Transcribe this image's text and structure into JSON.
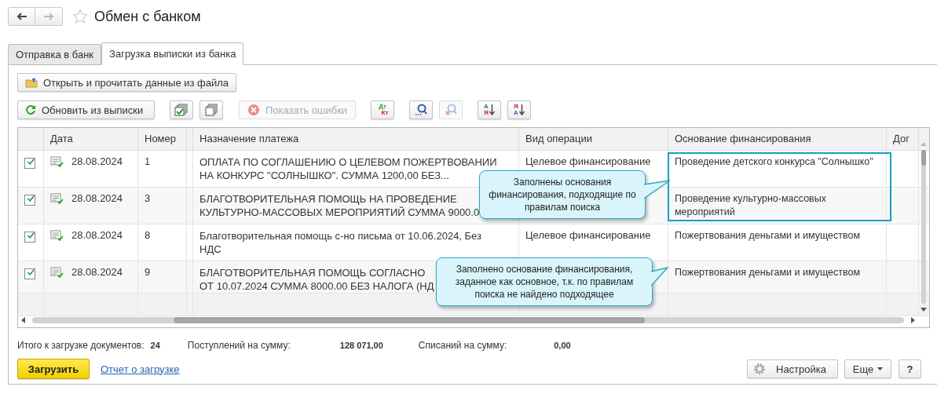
{
  "window": {
    "title": "Обмен с банком",
    "favorite": false
  },
  "tabs": [
    {
      "label": "Отправка в банк",
      "selected": false
    },
    {
      "label": "Загрузка выписки из банка",
      "selected": true
    }
  ],
  "open_button": {
    "label": "Открыть и прочитать данные из файла"
  },
  "toolbar": [
    {
      "kind": "text",
      "label": "Обновить из выписки",
      "disabled": false
    },
    {
      "kind": "check-all",
      "disabled": false
    },
    {
      "kind": "copy",
      "disabled": false
    },
    {
      "kind": "text",
      "label": "Показать ошибки",
      "disabled": true
    },
    {
      "kind": "dtkt",
      "top": "Дт",
      "bottom": "Кт",
      "disabled": false
    },
    {
      "kind": "search",
      "disabled": false
    },
    {
      "kind": "search-cancel",
      "disabled": true
    },
    {
      "kind": "sort-asc",
      "top": "А",
      "bottom": "Я",
      "disabled": false
    },
    {
      "kind": "sort-desc",
      "top": "Я",
      "bottom": "А",
      "disabled": false
    }
  ],
  "table": {
    "columns": [
      "Дата",
      "Номер",
      "Назначение платежа",
      "Вид операции",
      "Основание финансирования",
      "Дог"
    ],
    "rows": [
      {
        "checked": true,
        "date": "28.08.2024",
        "number": "1",
        "purpose_lines": [
          "ОПЛАТА ПО СОГЛАШЕНИЮ О ЦЕЛЕВОМ ПОЖЕРТВОВАНИИ",
          "НА КОНКУРС \"СОЛНЫШКО\". СУММА 1200,00 БЕЗ..."
        ],
        "operation": "Целевое финансирование",
        "basis": "Проведение детского конкурса \"Солнышко\""
      },
      {
        "checked": true,
        "date": "28.08.2024",
        "number": "3",
        "purpose_lines": [
          "БЛАГОТВОРИТЕЛЬНАЯ ПОМОЩЬ НА ПРОВЕДЕНИЕ",
          "КУЛЬТУРНО-МАССОВЫХ МЕРОПРИЯТИЙ СУММА 9000.0"
        ],
        "basis": "Проведение культурно-массовых мероприятий"
      },
      {
        "checked": true,
        "date": "28.08.2024",
        "number": "8",
        "purpose_lines": [
          "Благотворительная помощь с-но письма от 10.06.2024, Без",
          "НДС"
        ],
        "operation": "Целевое финансирование",
        "basis": "Пожертвования деньгами и имуществом"
      },
      {
        "checked": true,
        "date": "28.08.2024",
        "number": "9",
        "purpose_lines": [
          "БЛАГОТВОРИТЕЛЬНАЯ ПОМОЩЬ СОГЛАСНО",
          "ОТ 10.07.2024 СУММА 8000.00 БЕЗ НАЛОГА (НД"
        ],
        "basis": "Пожертвования деньгами и имуществом"
      }
    ]
  },
  "callouts": [
    {
      "text": "Заполнены основания финансирования, подходящие по правилам поиска"
    },
    {
      "text": "Заполнено основание финансирования, заданное как основное, т.к. по правилам поиска не найдено подходящее"
    }
  ],
  "totals": [
    {
      "label": "Итого к загрузке документов:",
      "value": "24"
    },
    {
      "label": "Поступлений на сумму:",
      "value": "128 071,00"
    },
    {
      "label": "Списаний на сумму:",
      "value": "0,00"
    }
  ],
  "footer": {
    "load_button": "Загрузить",
    "report_link": "Отчет о загрузке",
    "settings_button": "Настройка",
    "more_button": "Еще",
    "help_button": "?"
  }
}
